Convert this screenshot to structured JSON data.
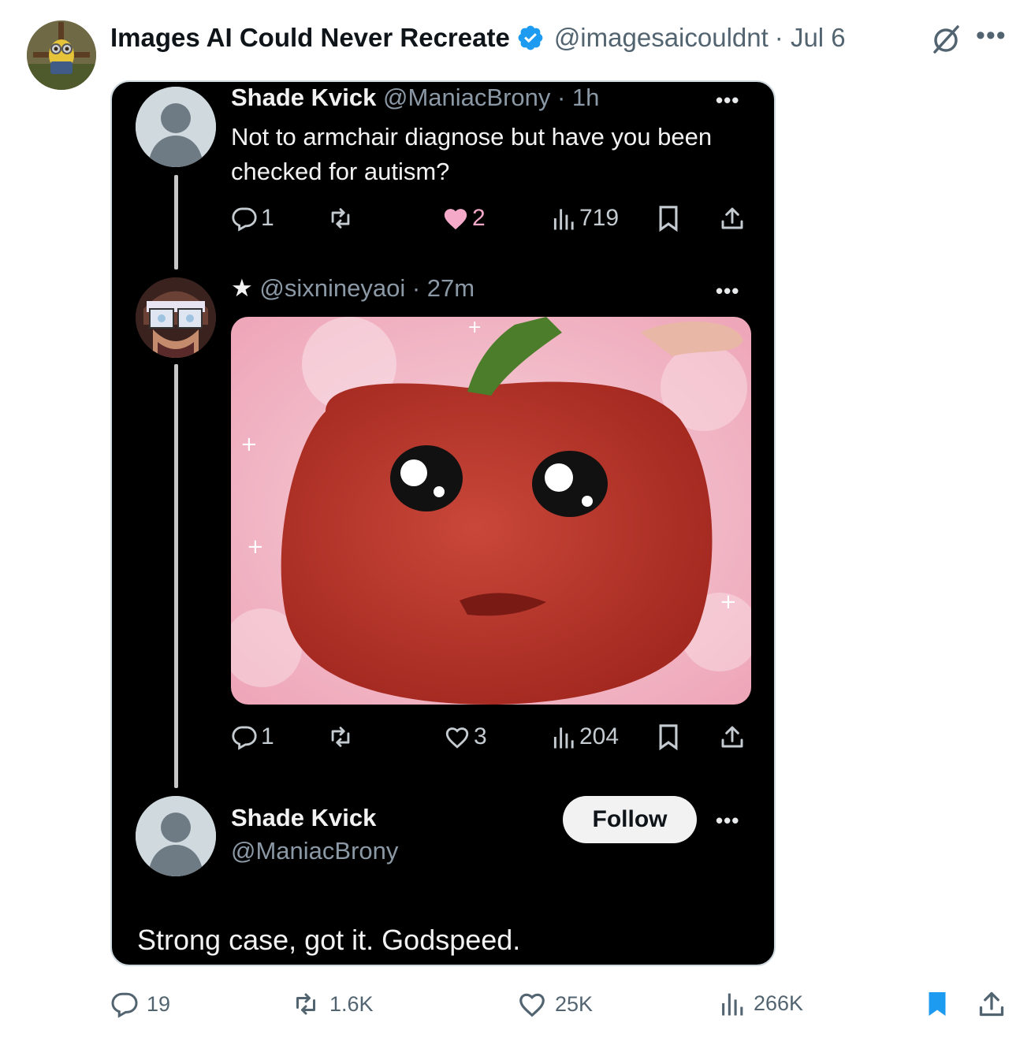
{
  "tweet": {
    "author_name": "Images AI Could Never Recreate",
    "author_handle": "@imagesaicouldnt",
    "date": "· Jul 6",
    "icons": {
      "verified": "verified-badge-icon",
      "grok": "grok-icon",
      "more": "more-icon"
    },
    "colors": {
      "verified": "#1d9bf0",
      "bookmark_active": "#1d9bf0",
      "text_secondary": "#536471"
    },
    "actions": {
      "replies": "19",
      "reposts": "1.6K",
      "likes": "25K",
      "views": "266K",
      "bookmarked": true
    }
  },
  "screenshot": {
    "reply1": {
      "name": "Shade Kvick",
      "meta": "@ManiacBrony · 1h",
      "text": "Not to armchair diagnose but have you been checked for autism?",
      "replies": "1",
      "likes": "2",
      "liked": true,
      "views": "719"
    },
    "reply2": {
      "star": "★",
      "meta": "@sixnineyaoi · 27m",
      "image_desc_icon": "crying-pepper-image",
      "replies": "1",
      "likes": "3",
      "liked": false,
      "views": "204"
    },
    "profile": {
      "name": "Shade Kvick",
      "handle": "@ManiacBrony",
      "follow_label": "Follow"
    },
    "final_text": "Strong case, got it. Godspeed.",
    "colors": {
      "background": "#000000",
      "liked": "#f4a9c9",
      "thread_line": "#c7c7c7"
    }
  }
}
